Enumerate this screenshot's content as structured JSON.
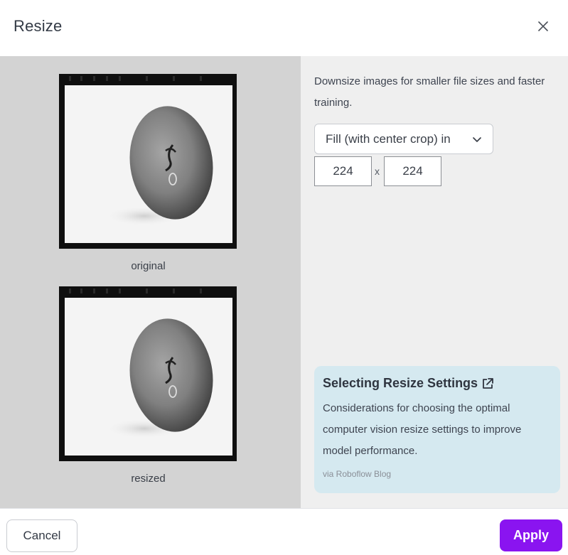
{
  "dialog": {
    "title": "Resize",
    "close_icon": "close-icon"
  },
  "preview": {
    "original_caption": "original",
    "resized_caption": "resized",
    "image_subject": "grayscale photo of a single fruit on white background with black film border"
  },
  "settings": {
    "description": "Downsize images for smaller file sizes and faster training.",
    "mode_selected": "Fill (with center crop) in",
    "mode_icon": "chevron-down-icon",
    "width_value": "224",
    "height_value": "224",
    "separator": "x"
  },
  "info_card": {
    "title": "Selecting Resize Settings",
    "title_icon": "external-link-icon",
    "body": "Considerations for choosing the optimal computer vision resize settings to improve model performance.",
    "source": "via Roboflow Blog"
  },
  "footer": {
    "cancel_label": "Cancel",
    "apply_label": "Apply"
  },
  "colors": {
    "accent": "#8a14f0",
    "info_card_bg": "#d5e9f0",
    "left_pane_bg": "#d3d3d3",
    "right_pane_bg": "#efefef"
  }
}
